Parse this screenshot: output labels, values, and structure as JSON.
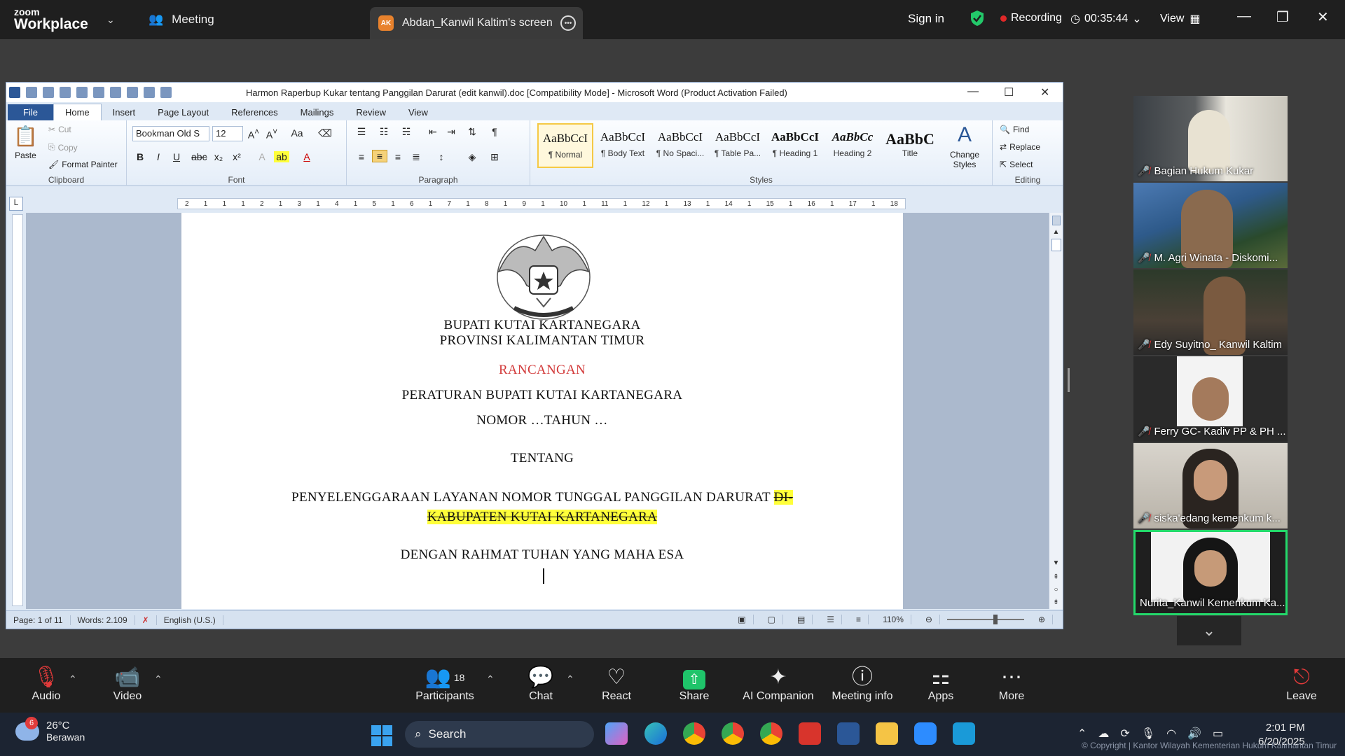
{
  "zoom": {
    "brand_line1": "zoom",
    "brand_line2": "Workplace",
    "meeting_label": "Meeting",
    "share_tab_initials": "AK",
    "share_tab_label": "Abdan_Kanwil Kaltim's screen",
    "signin": "Sign in",
    "recording_label": "Recording",
    "timer": "00:35:44",
    "view_label": "View"
  },
  "word": {
    "title": "Harmon Raperbup Kukar tentang Panggilan Darurat (edit kanwil).doc [Compatibility Mode]  -  Microsoft Word (Product Activation Failed)",
    "tabs": [
      "File",
      "Home",
      "Insert",
      "Page Layout",
      "References",
      "Mailings",
      "Review",
      "View"
    ],
    "clipboard": {
      "paste": "Paste",
      "cut": "Cut",
      "copy": "Copy",
      "format_painter": "Format Painter",
      "label": "Clipboard"
    },
    "font": {
      "name": "Bookman Old S",
      "size": "12",
      "label": "Font"
    },
    "paragraph_label": "Paragraph",
    "styles": [
      {
        "preview": "AaBbCcI",
        "name": "¶ Normal"
      },
      {
        "preview": "AaBbCcI",
        "name": "¶ Body Text"
      },
      {
        "preview": "AaBbCcI",
        "name": "¶ No Spaci..."
      },
      {
        "preview": "AaBbCcI",
        "name": "¶ Table Pa..."
      },
      {
        "preview": "AaBbCcI",
        "name": "¶ Heading 1"
      },
      {
        "preview": "AaBbCc",
        "name": "Heading 2"
      },
      {
        "preview": "AaBbC",
        "name": "Title"
      }
    ],
    "styles_label": "Styles",
    "change_styles": "Change Styles",
    "editing": {
      "find": "Find",
      "replace": "Replace",
      "select": "Select",
      "label": "Editing"
    },
    "ruler_ticks": [
      "2",
      "1",
      "1",
      "1",
      "2",
      "1",
      "3",
      "1",
      "4",
      "1",
      "5",
      "1",
      "6",
      "1",
      "7",
      "1",
      "8",
      "1",
      "9",
      "1",
      "10",
      "1",
      "11",
      "1",
      "12",
      "1",
      "13",
      "1",
      "14",
      "1",
      "15",
      "1",
      "16",
      "1",
      "17",
      "1",
      "18"
    ],
    "doc": {
      "line1": "BUPATI KUTAI KARTANEGARA",
      "line2": "PROVINSI KALIMANTAN TIMUR",
      "line3": "RANCANGAN",
      "line4": "PERATURAN BUPATI KUTAI KARTANEGARA",
      "line5": "NOMOR …TAHUN …",
      "line6": "TENTANG",
      "line7a": "PENYELENGGARAAN LAYANAN NOMOR TUNGGAL PANGGILAN DARURAT ",
      "line7b": "DI-",
      "line8": "KABUPATEN KUTAI KARTANEGARA",
      "line9": "DENGAN RAHMAT TUHAN YANG MAHA ESA"
    },
    "status": {
      "page": "Page: 1 of 11",
      "words": "Words: 2.109",
      "lang": "English (U.S.)",
      "zoom": "110%"
    }
  },
  "participants": [
    {
      "name": "Bagian Hukum Kukar",
      "muted": true
    },
    {
      "name": "M. Agri Winata - Diskomi...",
      "muted": true
    },
    {
      "name": "Edy Suyitno_ Kanwil Kaltim",
      "muted": true
    },
    {
      "name": "Ferry GC- Kadiv PP & PH ...",
      "muted": true
    },
    {
      "name": "siska'edang kemenkum k...",
      "muted": true
    },
    {
      "name": "Nurita_Kanwil Kemenkum Ka...",
      "muted": false
    }
  ],
  "toolbar": {
    "audio": "Audio",
    "video": "Video",
    "participants": "Participants",
    "participants_count": "18",
    "chat": "Chat",
    "react": "React",
    "share": "Share",
    "ai": "AI Companion",
    "info": "Meeting info",
    "apps": "Apps",
    "more": "More",
    "leave": "Leave"
  },
  "taskbar": {
    "weather_badge": "6",
    "temp": "26°C",
    "condition": "Berawan",
    "search": "Search",
    "time": "2:01 PM",
    "date": "6/20/2025",
    "copyright": "© Copyright | Kantor Wilayah Kementerian Hukum Kalimantan Timur"
  }
}
